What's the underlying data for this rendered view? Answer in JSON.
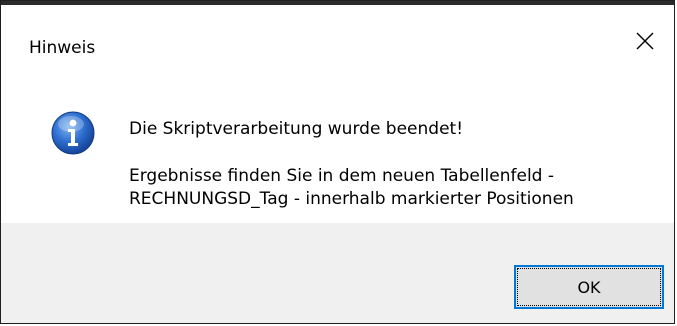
{
  "dialog": {
    "title": "Hinweis",
    "close_icon": "close-icon",
    "icon": "info-icon",
    "message_line1": "Die Skriptverarbeitung wurde beendet!",
    "message_line2": "Ergebnisse finden Sie in dem neuen Tabellenfeld -",
    "message_line3": "RECHNUNGSD_Tag - innerhalb markierter Positionen",
    "ok_label": "OK"
  },
  "colors": {
    "accent": "#0078d7",
    "footer_bg": "#f0f0f0",
    "button_bg": "#e1e1e1",
    "info_blue": "#1e5fbf"
  }
}
